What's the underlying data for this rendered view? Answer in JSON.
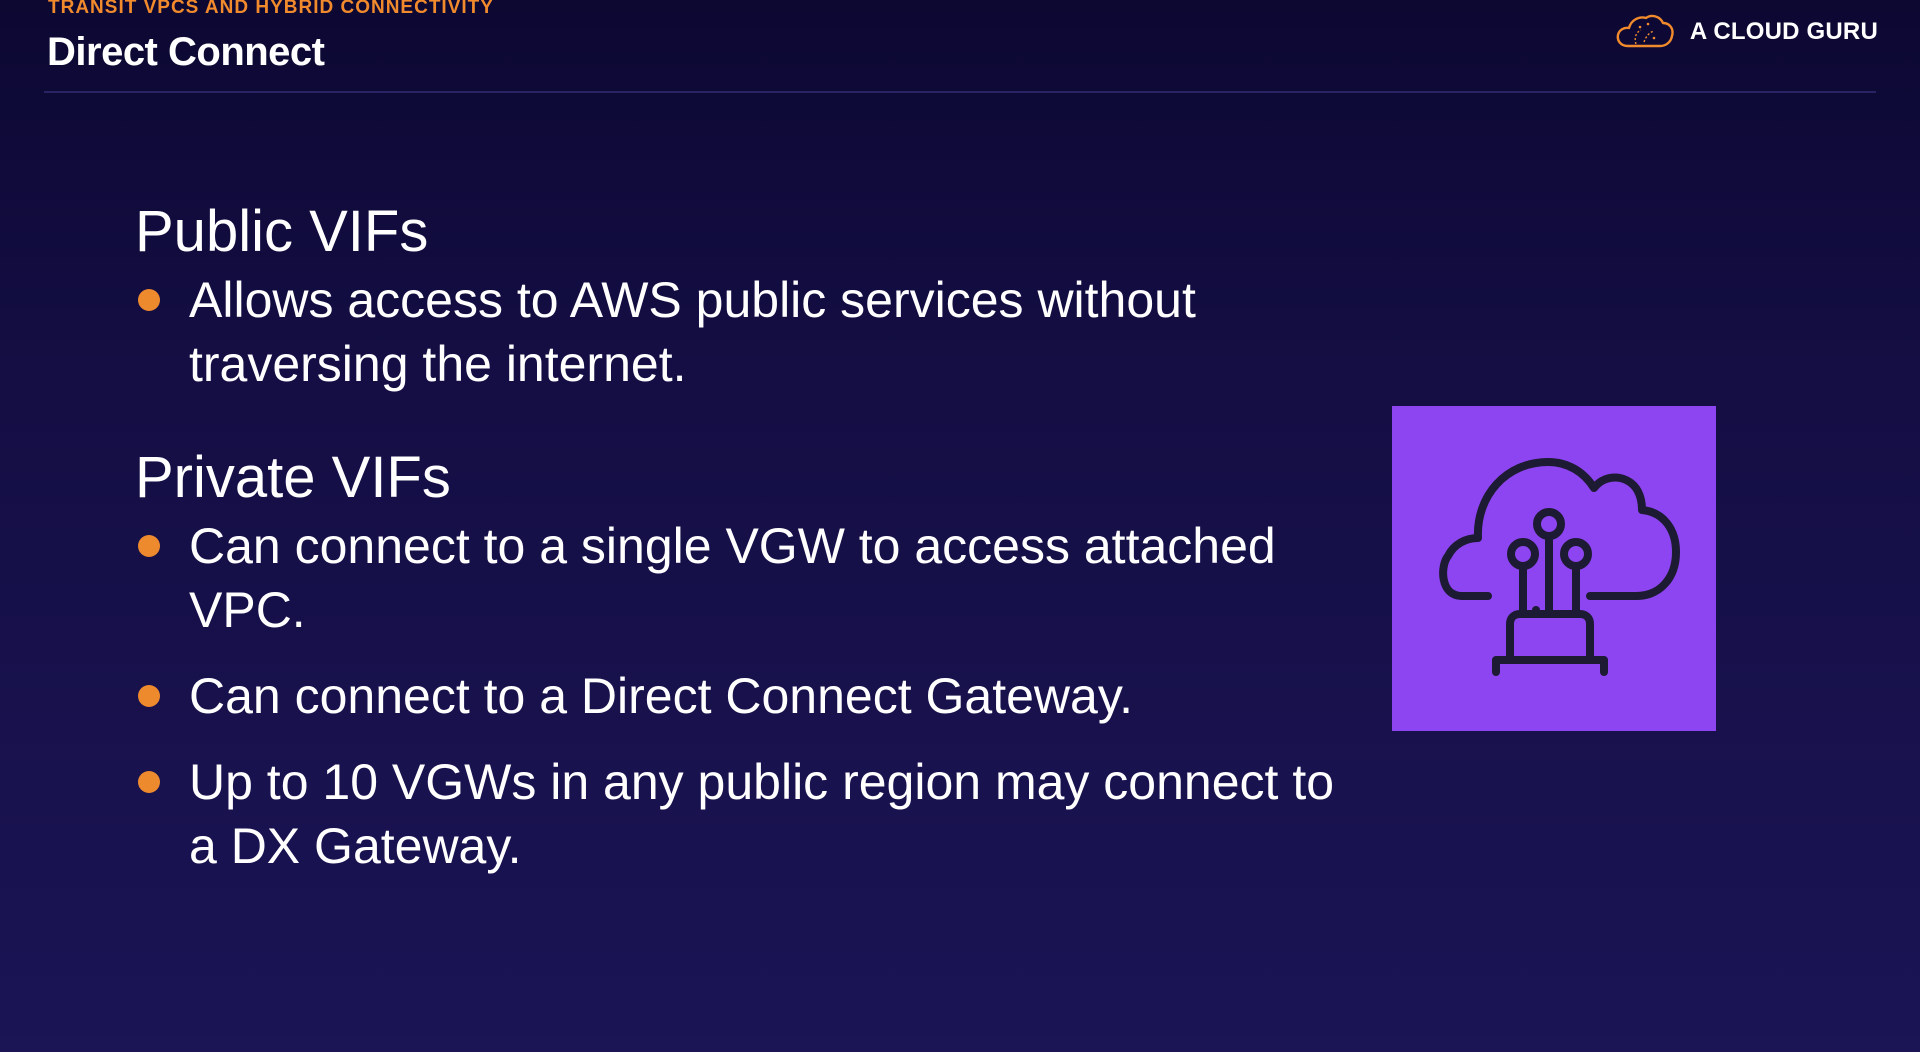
{
  "header": {
    "eyebrow": "TRANSIT VPCS AND HYBRID CONNECTIVITY",
    "title": "Direct Connect"
  },
  "brand": {
    "name": "A CLOUD GURU",
    "logo_icon": "cloud-logo-icon",
    "logo_color": "#f08a2c"
  },
  "sections": [
    {
      "heading": "Public VIFs",
      "bullets": [
        "Allows access to AWS public services without traversing the internet."
      ]
    },
    {
      "heading": "Private VIFs",
      "bullets": [
        "Can connect to a single VGW to access attached VPC.",
        "Can connect to a Direct Connect Gateway.",
        "Up to 10 VGWs in any public region may connect to a DX Gateway."
      ]
    }
  ],
  "illustration": {
    "icon": "aws-direct-connect-icon",
    "background_color": "#8c45f0",
    "stroke_color": "#1d1a33"
  },
  "colors": {
    "background": "#140e44",
    "accent": "#ee8a2e",
    "text": "#ffffff"
  }
}
